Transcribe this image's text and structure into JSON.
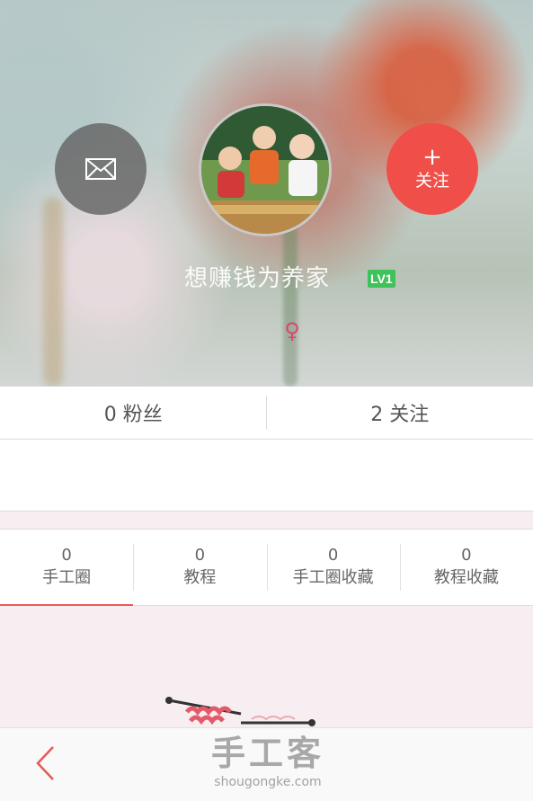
{
  "profile": {
    "username": "想赚钱为养家",
    "level": "LV1",
    "gender_symbol": "♀"
  },
  "actions": {
    "follow_plus": "+",
    "follow_label": "关注"
  },
  "stats": {
    "fans": "0 粉丝",
    "following": "2 关注"
  },
  "tabs": [
    {
      "count": "0",
      "label": "手工圈"
    },
    {
      "count": "0",
      "label": "教程"
    },
    {
      "count": "0",
      "label": "手工圈收藏"
    },
    {
      "count": "0",
      "label": "教程收藏"
    }
  ],
  "watermark": {
    "cn": "手工客",
    "en": "shougongke.com"
  },
  "colors": {
    "accent": "#ef4f48",
    "level_badge": "#3fc25a",
    "gender": "#e0446f"
  },
  "icons": [
    "mail-icon",
    "plus-icon",
    "female-icon",
    "back-chevron-icon",
    "knitting-illustration"
  ]
}
